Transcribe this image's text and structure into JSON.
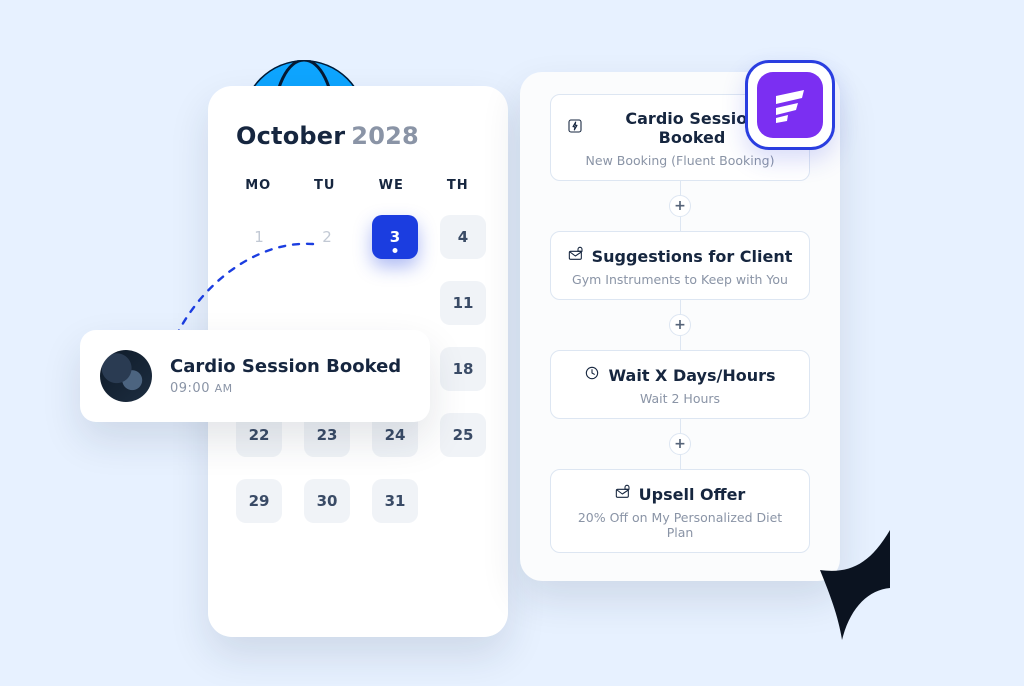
{
  "calendar": {
    "month": "October",
    "year": "2028",
    "dow": [
      "MO",
      "TU",
      "WE",
      "TH"
    ],
    "cells": [
      {
        "n": "1",
        "muted": true
      },
      {
        "n": "2",
        "muted": true
      },
      {
        "n": "3",
        "selected": true
      },
      {
        "n": "4"
      },
      {
        "n": "",
        "blank": true
      },
      {
        "n": "",
        "blank": true
      },
      {
        "n": "",
        "blank": true
      },
      {
        "n": "11"
      },
      {
        "n": "",
        "blank": true
      },
      {
        "n": "",
        "blank": true
      },
      {
        "n": "",
        "blank": true
      },
      {
        "n": "18"
      },
      {
        "n": "22"
      },
      {
        "n": "23"
      },
      {
        "n": "24"
      },
      {
        "n": "25"
      },
      {
        "n": "29"
      },
      {
        "n": "30"
      },
      {
        "n": "31"
      }
    ]
  },
  "event": {
    "title": "Cardio Session Booked",
    "time": "09:00",
    "ampm": "AM"
  },
  "flow": {
    "steps": [
      {
        "icon": "bolt",
        "title": "Cardio Session Booked",
        "sub": "New Booking (Fluent Booking)"
      },
      {
        "icon": "mail",
        "title": "Suggestions for Client",
        "sub": "Gym Instruments to Keep with You"
      },
      {
        "icon": "clock",
        "title": "Wait X Days/Hours",
        "sub": "Wait 2 Hours"
      },
      {
        "icon": "mail",
        "title": "Upsell Offer",
        "sub": "20% Off on My Personalized Diet Plan"
      }
    ],
    "plus_label": "+"
  },
  "badge": {
    "name": "fluent-brand-icon"
  }
}
